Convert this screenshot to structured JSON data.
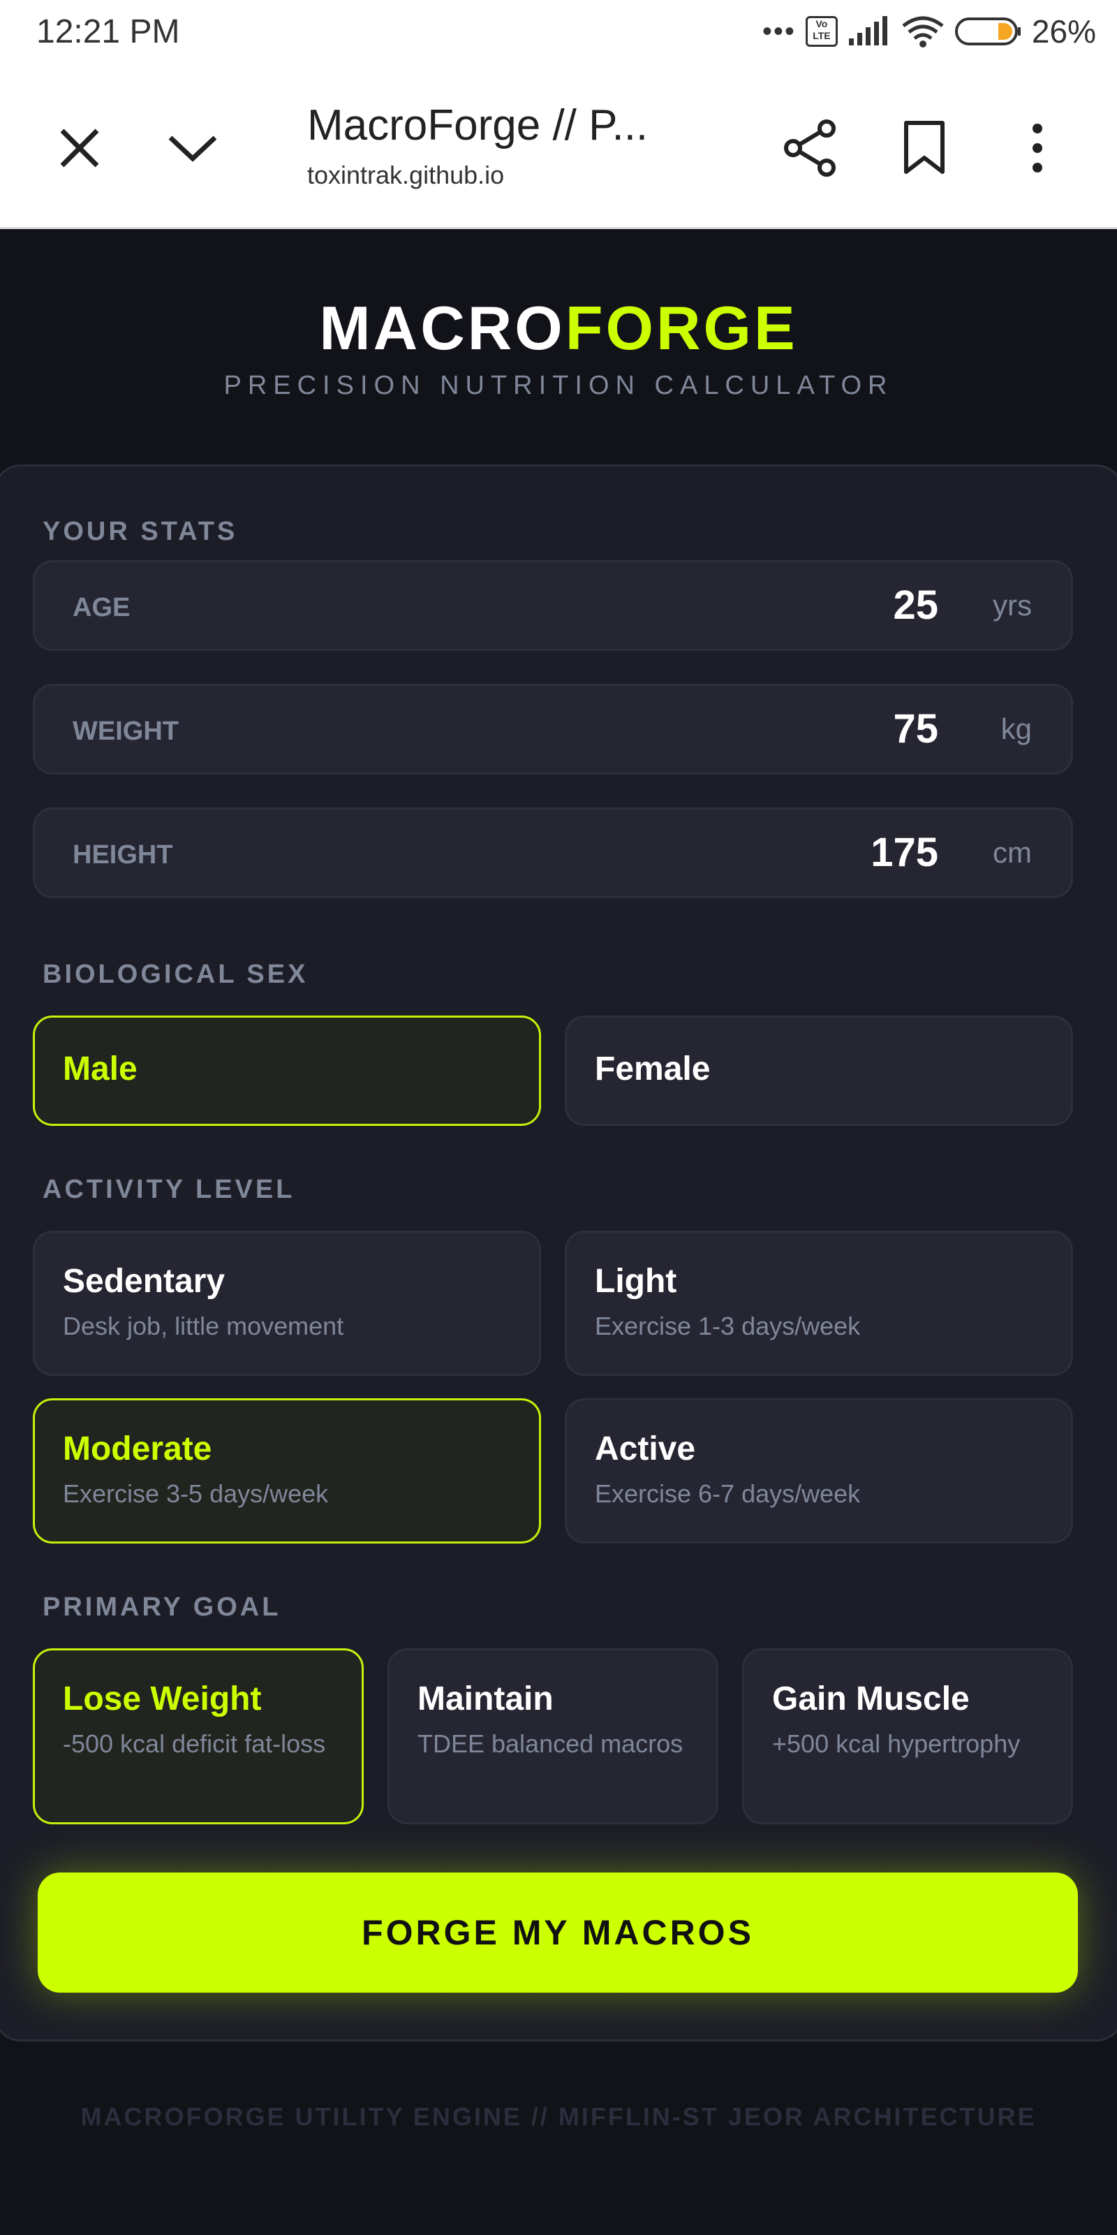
{
  "status_bar": {
    "time": "12:21 PM",
    "dots": "•••",
    "volte": "Vo LTE",
    "battery": "26%",
    "icons": [
      "signal-icon",
      "wifi-icon",
      "battery-icon"
    ]
  },
  "browser": {
    "title": "MacroForge // P...",
    "url": "toxintrak.github.io",
    "icons": [
      "close-icon",
      "chevron-down-icon",
      "share-icon",
      "bookmark-icon",
      "more-vertical-icon"
    ]
  },
  "hero": {
    "title_white": "MACRO",
    "title_green": "FORGE",
    "subtitle": "PRECISION NUTRITION CALCULATOR"
  },
  "stats": {
    "label": "YOUR STATS",
    "age": {
      "label": "AGE",
      "value": "25",
      "unit": "yrs"
    },
    "weight": {
      "label": "WEIGHT",
      "value": "75",
      "unit": "kg"
    },
    "height": {
      "label": "HEIGHT",
      "value": "175",
      "unit": "cm"
    }
  },
  "sex": {
    "label": "BIOLOGICAL SEX",
    "options": [
      {
        "title": "Male",
        "selected": true
      },
      {
        "title": "Female",
        "selected": false
      }
    ]
  },
  "activity": {
    "label": "ACTIVITY LEVEL",
    "options": [
      {
        "title": "Sedentary",
        "desc": "Desk job, little movement",
        "selected": false
      },
      {
        "title": "Light",
        "desc": "Exercise 1-3 days/week",
        "selected": false
      },
      {
        "title": "Moderate",
        "desc": "Exercise 3-5 days/week",
        "selected": true
      },
      {
        "title": "Active",
        "desc": "Exercise 6-7 days/week",
        "selected": false
      }
    ]
  },
  "goal": {
    "label": "PRIMARY GOAL",
    "options": [
      {
        "title": "Lose Weight",
        "desc": "-500 kcal deficit fat-loss",
        "selected": true
      },
      {
        "title": "Maintain",
        "desc": "TDEE balanced macros",
        "selected": false
      },
      {
        "title": "Gain Muscle",
        "desc": "+500 kcal hypertrophy",
        "selected": false
      }
    ]
  },
  "cta": {
    "label": "FORGE MY MACROS"
  },
  "footer": {
    "text": "MACROFORGE UTILITY ENGINE // MIFFLIN-ST JEOR ARCHITECTURE"
  },
  "colors": {
    "accent": "#ccff00",
    "background": "#121219",
    "card": "#1d1d27",
    "muted": "#7f8799"
  }
}
